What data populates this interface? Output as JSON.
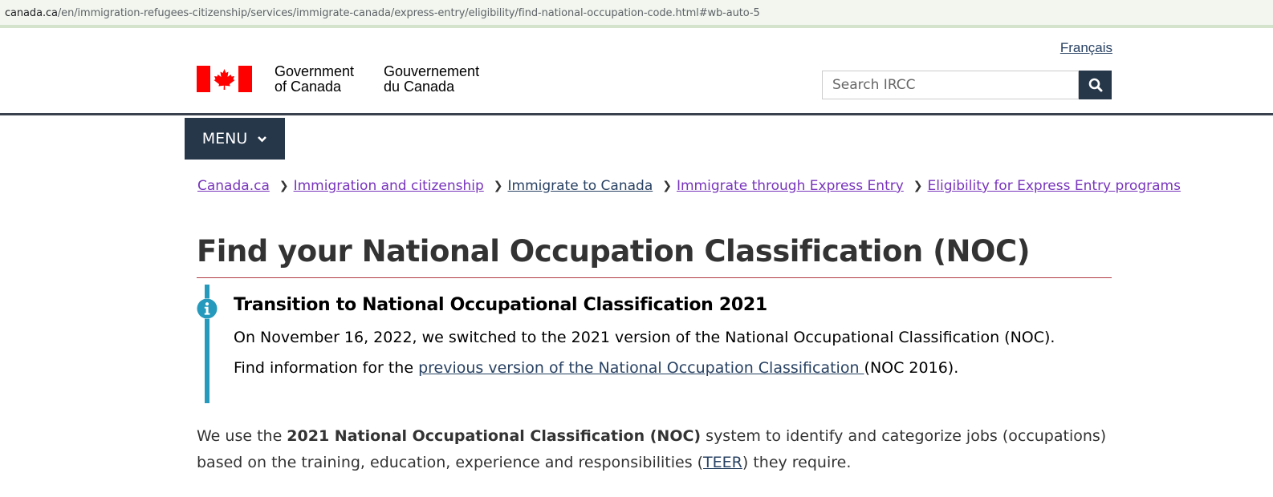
{
  "browser": {
    "url_host": "canada.ca",
    "url_path": "/en/immigration-refugees-citizenship/services/immigrate-canada/express-entry/eligibility/find-national-occupation-code.html#wb-auto-5"
  },
  "header": {
    "language_link": "Français",
    "signature_en_line1": "Government",
    "signature_en_line2": "of Canada",
    "signature_fr_line1": "Gouvernement",
    "signature_fr_line2": "du Canada",
    "search_placeholder": "Search IRCC",
    "search_icon": "search-icon",
    "flag_color": "#ff0000"
  },
  "menu": {
    "label": "MENU",
    "icon": "chevron-down-icon"
  },
  "breadcrumb": [
    "Canada.ca",
    "Immigration and citizenship",
    "Immigrate to Canada",
    "Immigrate through Express Entry",
    "Eligibility for Express Entry programs"
  ],
  "page": {
    "title": "Find your National Occupation Classification (NOC)"
  },
  "alert": {
    "icon": "info-icon",
    "heading": "Transition to National Occupational Classification 2021",
    "line1": "On November 16, 2022, we switched to the 2021 version of the National Occupational Classification (NOC).",
    "line2_prefix": "Find information for the ",
    "line2_link": "previous version of the National Occupation Classification ",
    "line2_suffix": "(NOC 2016).",
    "accent_color": "#269abc"
  },
  "intro": {
    "prefix": "We use the ",
    "bold": "2021 National Occupational Classification (NOC)",
    "middle": " system to identify and categorize jobs (occupations) based on the training, education, experience and responsibilities (",
    "link": "TEER",
    "suffix": ") they require."
  },
  "colors": {
    "navy": "#26374a",
    "link": "#284162",
    "visited_link": "#7834bc",
    "title_rule": "#af3c43"
  }
}
